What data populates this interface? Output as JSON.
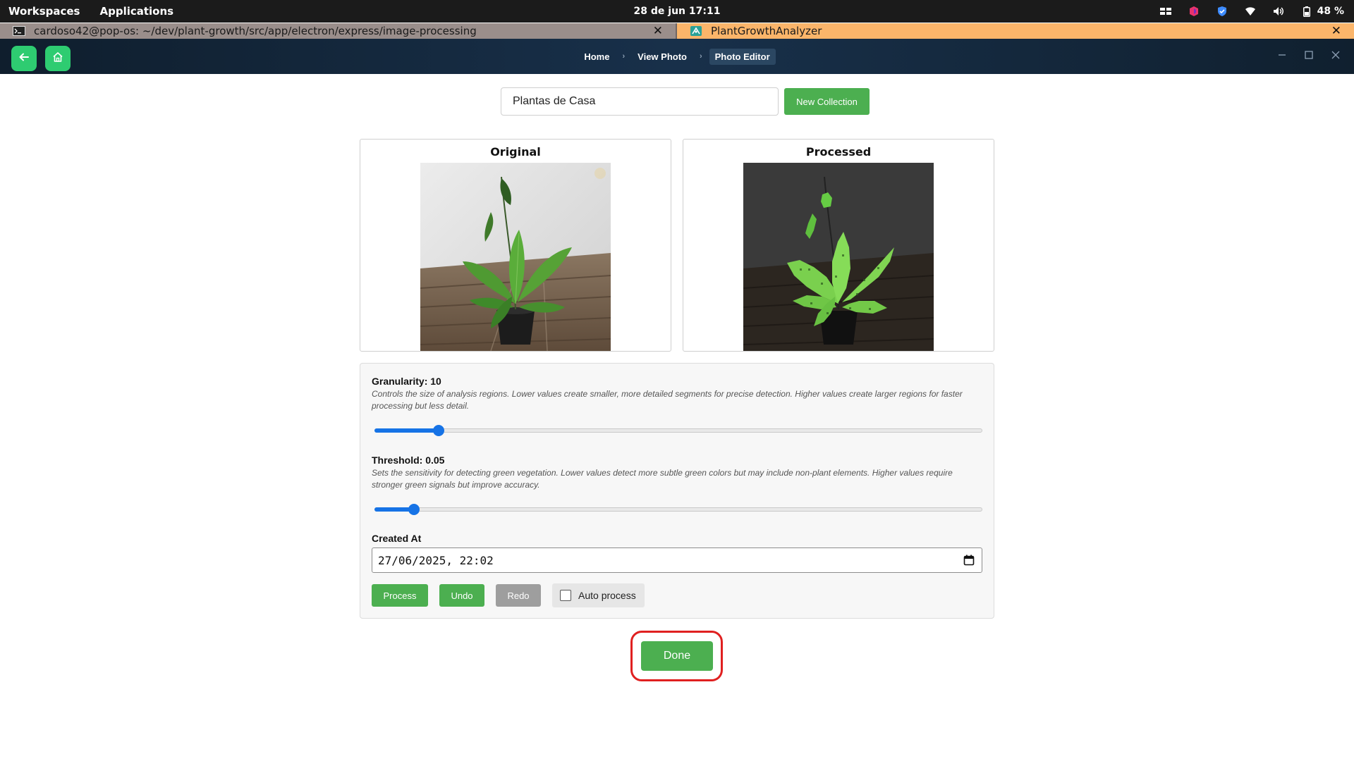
{
  "os_bar": {
    "workspaces": "Workspaces",
    "applications": "Applications",
    "clock": "28 de jun  17:11",
    "battery": "48 %"
  },
  "tabs": [
    {
      "title": "cardoso42@pop-os: ~/dev/plant-growth/src/app/electron/express/image-processing",
      "close": "✕",
      "icon": "terminal-icon"
    },
    {
      "title": "PlantGrowthAnalyzer",
      "close": "✕",
      "icon": "app-icon"
    }
  ],
  "header": {
    "breadcrumb": [
      "Home",
      "View Photo",
      "Photo Editor"
    ],
    "separator": "›"
  },
  "collection": {
    "value": "Plantas de Casa",
    "new_label": "New Collection"
  },
  "panels": {
    "original_title": "Original",
    "processed_title": "Processed"
  },
  "granularity": {
    "label": "Granularity: 10",
    "description": "Controls the size of analysis regions. Lower values create smaller, more detailed segments for precise detection. Higher values create larger regions for faster processing but less detail.",
    "level": 0.105
  },
  "threshold": {
    "label": "Threshold: 0.05",
    "description": "Sets the sensitivity for detecting green vegetation. Lower values detect more subtle green colors but may include non-plant elements. Higher values require stronger green signals but improve accuracy.",
    "level": 0.065
  },
  "created_at": {
    "label": "Created At",
    "value": "27/06/2025, 22:02"
  },
  "actions": {
    "process": "Process",
    "undo": "Undo",
    "redo": "Redo",
    "auto_process": "Auto process",
    "done": "Done"
  },
  "colors": {
    "primary": "#4caf50",
    "disabled": "#9e9e9e",
    "slider": "#1673e6",
    "highlight": "#e02020",
    "app_tab": "#fbb56a"
  }
}
